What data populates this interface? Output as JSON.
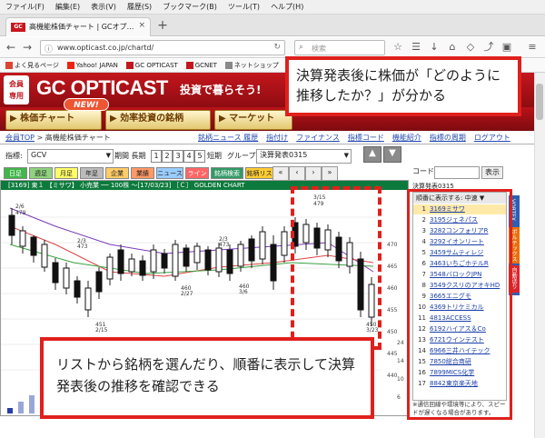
{
  "browser": {
    "menu": [
      "ファイル(F)",
      "編集(E)",
      "表示(V)",
      "履歴(S)",
      "ブックマーク(B)",
      "ツール(T)",
      "ヘルプ(H)"
    ],
    "tab_title": "高機能株価チャート | GCオプ…",
    "url": "www.opticast.co.jp/chartd/",
    "search_placeholder": "検索",
    "bookmarks": [
      "よく見るページ",
      "Yahoo! JAPAN",
      "GC OPTICAST",
      "GCNET",
      "ネットショップ",
      "[D"
    ]
  },
  "site": {
    "member": "会員\n専用",
    "logo": "GC OPTICAST",
    "tagline": "投資で暮らそう!",
    "new_badge": "NEW!",
    "nav": [
      "株価チャート",
      "効率投資の銘柄",
      "マーケット"
    ],
    "breadcrumb_home": "会員TOP",
    "breadcrumb_current": " > 高機能株価チャート",
    "sublinks": [
      "銘柄ニュース 履歴",
      "指付け",
      "ファイナンス",
      "指標コード",
      "機能紹介",
      "指標の周期",
      "ログアウト"
    ]
  },
  "toolbar": {
    "indicator_label": "指標:",
    "indicator_value": "GCV",
    "period_label": "期間 長期",
    "period_buttons": [
      "1",
      "2",
      "3",
      "4",
      "5"
    ],
    "short_label": "短期",
    "group_label": "グループ:",
    "group_value": "決算発表0315",
    "nav_prev_prev": "«",
    "nav_prev": "‹",
    "nav_next": "›",
    "nav_next_next": "»"
  },
  "indicators": [
    {
      "label": "日足",
      "bg": "#41b649",
      "fg": "#ffffff"
    },
    {
      "label": "週足",
      "bg": "#8fd37d",
      "fg": "#222222"
    },
    {
      "label": "月足",
      "bg": "#ffff66",
      "fg": "#222222"
    },
    {
      "label": "年足",
      "bg": "#bbbbbb",
      "fg": "#222222"
    },
    {
      "label": "企業",
      "bg": "#ffcc66",
      "fg": "#222222"
    },
    {
      "label": "業績",
      "bg": "#ff9966",
      "fg": "#222222"
    },
    {
      "label": "ニュース",
      "bg": "#99ccff",
      "fg": "#222222"
    },
    {
      "label": "ライン",
      "bg": "#ff6666",
      "fg": "#ffffff"
    },
    {
      "label": "銘柄検索",
      "bg": "#339966",
      "fg": "#ffffff"
    },
    {
      "label": "銘柄リスト",
      "bg": "#ffcc33",
      "fg": "#222222"
    }
  ],
  "chart": {
    "header": "[3169] 東１ 【ミサワ】 小売業                    ── 100株                  ～[17/03/23] ［Ｃ］ GOLDEN CHART",
    "price_labels": [
      "470",
      "465",
      "460",
      "455",
      "450",
      "445",
      "440"
    ],
    "annotations": [
      {
        "text": "2/6"
      },
      {
        "text": "479"
      },
      {
        "text": "3/15"
      },
      {
        "text": "479"
      },
      {
        "text": "2/3"
      },
      {
        "text": "473"
      },
      {
        "text": "2/3"
      },
      {
        "text": "473"
      },
      {
        "text": "451"
      },
      {
        "text": "2/15"
      },
      {
        "text": "460"
      },
      {
        "text": "2/27"
      },
      {
        "text": "460"
      },
      {
        "text": "3/6"
      },
      {
        "text": "450"
      },
      {
        "text": "3/23"
      }
    ],
    "right_axis_labels": [
      "24",
      "14",
      "10",
      "6"
    ]
  },
  "right_panel": {
    "code_label": "コード:",
    "display_button": "表示",
    "list_title": "決算発表0315",
    "list_header": "順番に表示する: 中速",
    "stocks": [
      {
        "no": "1",
        "name": "3169ミサワ"
      },
      {
        "no": "2",
        "name": "3195ジェネパス"
      },
      {
        "no": "3",
        "name": "3282コンフォリアR"
      },
      {
        "no": "4",
        "name": "3292イオンリート"
      },
      {
        "no": "5",
        "name": "3459サムティレジ"
      },
      {
        "no": "6",
        "name": "3463いちごホテルR"
      },
      {
        "no": "7",
        "name": "3548バロックJPN"
      },
      {
        "no": "8",
        "name": "3549クスリのアオキHD"
      },
      {
        "no": "9",
        "name": "3665エニグモ"
      },
      {
        "no": "10",
        "name": "4369トリケミカル"
      },
      {
        "no": "11",
        "name": "4813ACCESS"
      },
      {
        "no": "12",
        "name": "6192ハイアス＆Co"
      },
      {
        "no": "13",
        "name": "6721ウインテスト"
      },
      {
        "no": "14",
        "name": "6966三井ハイテック"
      },
      {
        "no": "15",
        "name": "7850総合商研"
      },
      {
        "no": "16",
        "name": "7899MICS化学"
      },
      {
        "no": "17",
        "name": "8842東京楽天地"
      }
    ],
    "note": "※通信回線や環境等により、スピードが遅くなる場合があります。",
    "side_tabs": [
      "VORTEX",
      "ボルテックス",
      "自動送り"
    ]
  },
  "callouts": {
    "top": "決算発表後に株価が「どのように推移したか？」が分かる",
    "bottom": "リストから銘柄を選んだり、順番に表示して決算発表後の推移を確認できる"
  },
  "colors": {
    "brand_red": "#c3161d",
    "callout_red": "#e0201c",
    "chart_header_green": "#0c7a3c",
    "link_blue": "#1a3ea8"
  }
}
